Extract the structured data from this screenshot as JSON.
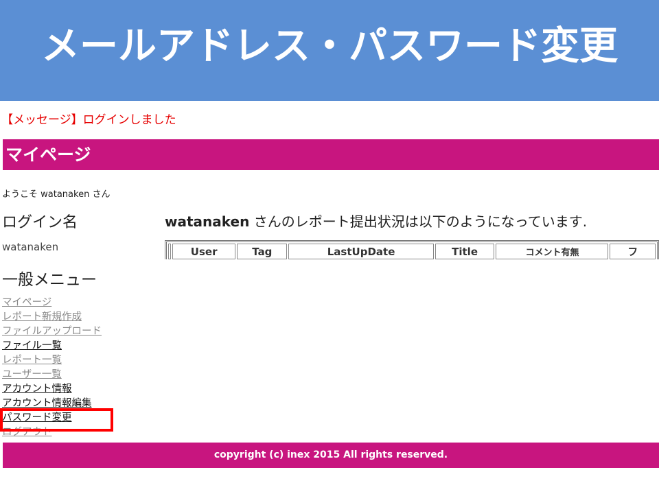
{
  "slide": {
    "title": "メールアドレス・パスワード変更"
  },
  "message": "【メッセージ】ログインしました",
  "mypage": {
    "title": "マイページ"
  },
  "welcome": {
    "prefix": "ようこそ ",
    "user": "watanaken",
    "suffix": " さん"
  },
  "sidebar": {
    "login_heading": "ログイン名",
    "login_name": "watanaken",
    "menu_heading": "一般メニュー",
    "items": [
      {
        "label": "マイページ",
        "style": "grey"
      },
      {
        "label": "レポート新規作成",
        "style": "grey"
      },
      {
        "label": "ファイルアップロード",
        "style": "grey"
      },
      {
        "label": "ファイル一覧",
        "style": "dark"
      },
      {
        "label": "レポート一覧",
        "style": "grey"
      },
      {
        "label": "ユーザー一覧",
        "style": "grey"
      },
      {
        "label": "アカウント情報",
        "style": "dark"
      },
      {
        "label": "アカウント情報編集",
        "style": "dark"
      },
      {
        "label": "パスワード変更",
        "style": "dark"
      },
      {
        "label": "ログアウト",
        "style": "grey"
      }
    ]
  },
  "main": {
    "status_user": "watanaken",
    "status_text": " さんのレポート提出状況は以下のようになっています."
  },
  "report_table": {
    "headers": [
      "User",
      "Tag",
      "LastUpDate",
      "Title",
      "コメント有無",
      "フ"
    ]
  },
  "footer": {
    "text": "copyright (c) inex 2015 All rights reserved."
  },
  "colors": {
    "slide_header": "#5b8fd4",
    "brand_magenta": "#c8157f",
    "message_red": "#e60000",
    "highlight_red": "#ff0000"
  }
}
